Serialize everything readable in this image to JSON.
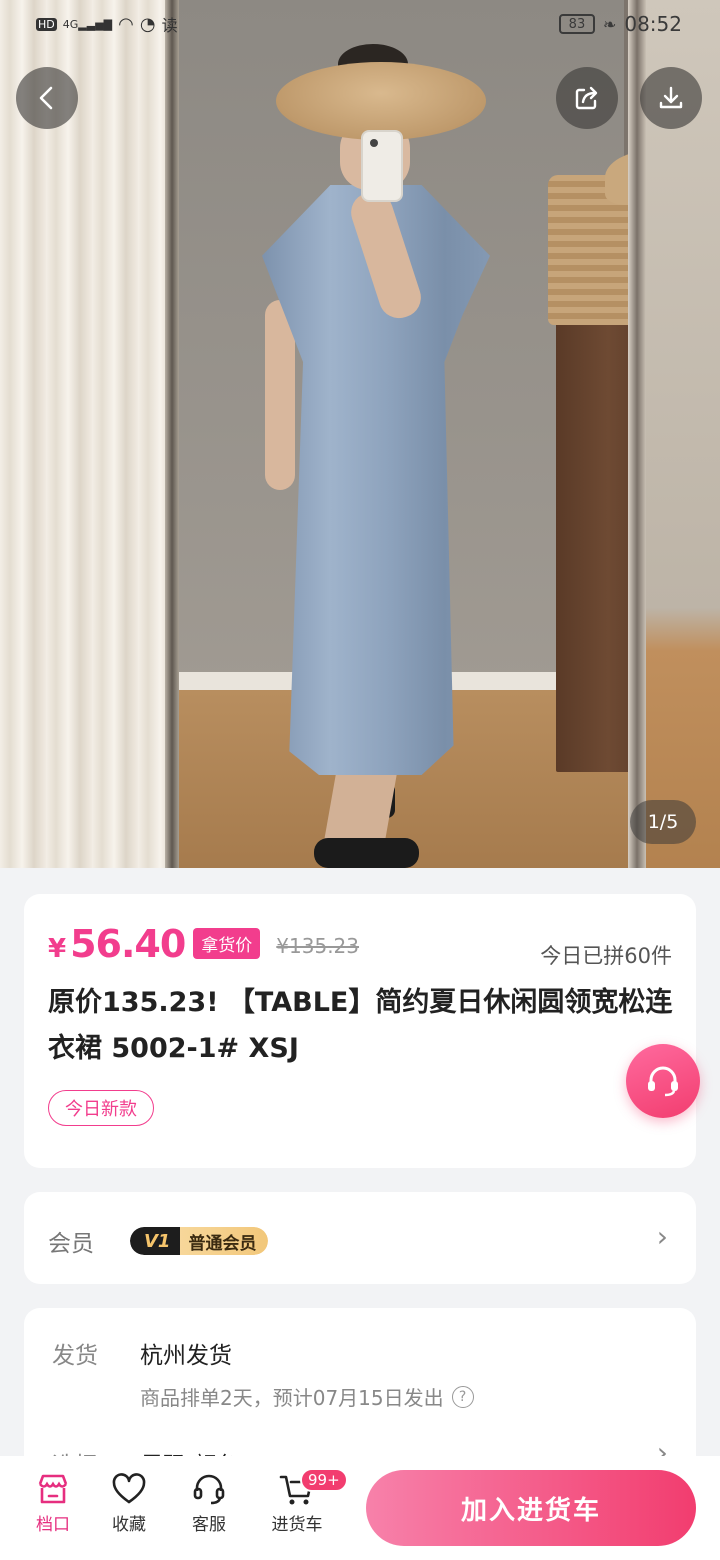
{
  "status_bar": {
    "hd": "HD",
    "net": "4G",
    "reader": "读",
    "battery": "83",
    "time": "08:52"
  },
  "gallery": {
    "counter": "1/5"
  },
  "product": {
    "currency": "¥",
    "price": "56.40",
    "price_tag": "拿货价",
    "original_price": "¥135.23",
    "sold_today": "今日已拼60件",
    "title": "原价135.23! 【TABLE】简约夏日休闲圆领宽松连衣裙  5002-1#  XSJ",
    "tag": "今日新款"
  },
  "member": {
    "label": "会员",
    "level_mark": "V1",
    "level_name": "普通会员"
  },
  "shipping": {
    "label": "发货",
    "origin": "杭州发货",
    "note": "商品排单2天，预计07月15日发出",
    "select_label": "选择",
    "select_value": "尺码  颜色"
  },
  "bottom_nav": {
    "items": [
      {
        "label": "档口",
        "icon": "store-icon"
      },
      {
        "label": "收藏",
        "icon": "heart-icon"
      },
      {
        "label": "客服",
        "icon": "headset-icon"
      },
      {
        "label": "进货车",
        "icon": "cart-icon"
      }
    ],
    "cart_badge": "99+",
    "add_to_cart": "加入进货车"
  },
  "colors": {
    "accent": "#f23d8d",
    "button_gradient_start": "#f781aa",
    "button_gradient_end": "#f23d6f"
  }
}
